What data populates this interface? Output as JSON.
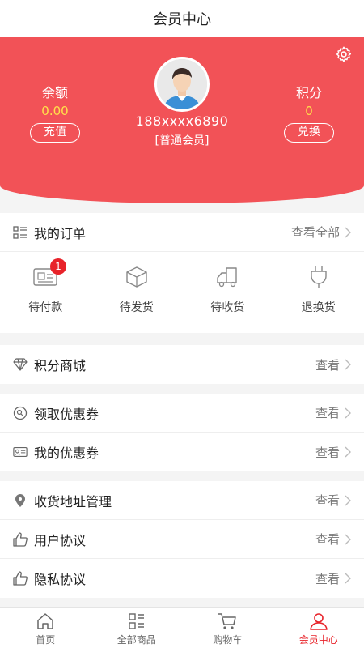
{
  "header": {
    "title": "会员中心"
  },
  "profile": {
    "balance_label": "余额",
    "balance_value": "0.00",
    "recharge_label": "充值",
    "points_label": "积分",
    "points_value": "0",
    "exchange_label": "兑换",
    "phone": "188xxxx6890",
    "level": "[普通会员]",
    "settings_icon": "gear-icon"
  },
  "orders": {
    "title": "我的订单",
    "view_all": "查看全部",
    "items": [
      {
        "label": "待付款",
        "icon": "payment-card-icon",
        "badge": "1"
      },
      {
        "label": "待发货",
        "icon": "box-icon"
      },
      {
        "label": "待收货",
        "icon": "truck-icon"
      },
      {
        "label": "退换货",
        "icon": "plug-return-icon"
      }
    ]
  },
  "menu": {
    "points_mall": {
      "label": "积分商城",
      "action": "查看"
    },
    "get_coupon": {
      "label": "领取优惠券",
      "action": "查看"
    },
    "my_coupon": {
      "label": "我的优惠券",
      "action": "查看"
    },
    "address": {
      "label": "收货地址管理",
      "action": "查看"
    },
    "user_agreement": {
      "label": "用户协议",
      "action": "查看"
    },
    "privacy": {
      "label": "隐私协议",
      "action": "查看"
    }
  },
  "tabbar": {
    "items": [
      {
        "label": "首页",
        "icon": "home-icon"
      },
      {
        "label": "全部商品",
        "icon": "grid-list-icon"
      },
      {
        "label": "购物车",
        "icon": "cart-icon"
      },
      {
        "label": "会员中心",
        "icon": "user-icon",
        "active": true
      }
    ]
  },
  "colors": {
    "accent": "#f25257",
    "highlight": "#ffe14a",
    "badge": "#e8232a"
  }
}
